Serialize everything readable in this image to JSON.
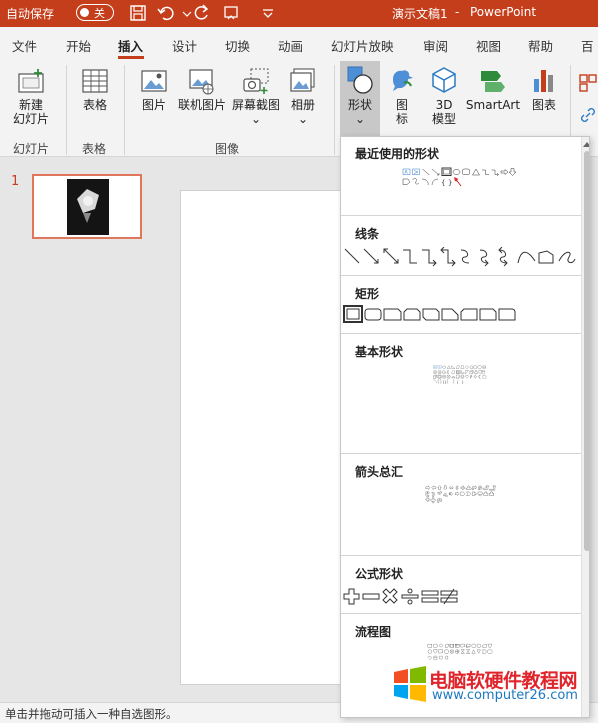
{
  "titlebar": {
    "autosave_label": "自动保存",
    "toggle_label": "关",
    "doc_title": "演示文稿1",
    "separator": "-",
    "app_name": "PowerPoint"
  },
  "tabs": [
    "文件",
    "开始",
    "插入",
    "设计",
    "切换",
    "动画",
    "幻灯片放映",
    "审阅",
    "视图",
    "帮助",
    "百度"
  ],
  "active_tab": "插入",
  "ribbon": {
    "new_slide": [
      "新建",
      "幻灯片"
    ],
    "table": "表格",
    "picture": "图片",
    "online_picture": "联机图片",
    "screenshot": "屏幕截图",
    "album": "相册",
    "shapes": "形状",
    "icons": [
      "图",
      "标"
    ],
    "model3d": [
      "3D",
      "模型"
    ],
    "smartart": "SmartArt",
    "chart": "图表",
    "groups": {
      "slides": "幻灯片",
      "tables": "表格",
      "images": "图像"
    }
  },
  "slides": [
    {
      "number": "1"
    }
  ],
  "status": "单击并拖动可插入一种自选图形。",
  "shapes_menu": {
    "sections": {
      "recent": "最近使用的形状",
      "lines": "线条",
      "rectangles": "矩形",
      "basic": "基本形状",
      "arrows": "箭头总汇",
      "equation": "公式形状",
      "flowchart": "流程图"
    }
  },
  "watermark": {
    "name": "电脑软硬件教程网",
    "url": "www.computer26.com"
  },
  "colors": {
    "accent": "#c43e1c",
    "arrow": "#e0242b",
    "watermark_blue": "#1d78c1"
  },
  "icons": [
    "save-icon",
    "undo-icon",
    "redo-icon",
    "more-icon",
    "shape-icon",
    "icon-bird-icon",
    "cube-icon",
    "smartart-icon",
    "chart-icon"
  ]
}
